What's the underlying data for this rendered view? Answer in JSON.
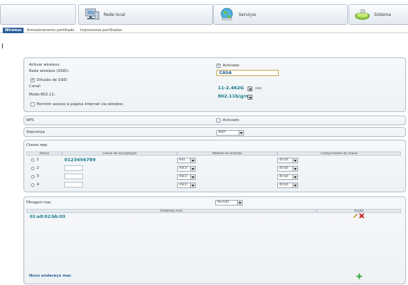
{
  "nav": {
    "tabs": [
      {
        "label": "Rede local",
        "icon": "network-monitor-icon"
      },
      {
        "label": "Serviços",
        "icon": "globe-icon"
      },
      {
        "label": "Sistema",
        "icon": "system-device-icon"
      }
    ]
  },
  "subtabs": [
    "Wireless",
    "Armazenamento partilhado",
    "Impressoras partilhadas"
  ],
  "wireless": {
    "activate_label": "Activar wireless:",
    "activate_checkbox": "Activado",
    "ssid_label": "Rede wireless (SSID):",
    "ssid_value": "CASA",
    "ssid_broadcast": "Difusão de SSID",
    "channel_label": "Canal:",
    "channel_value": "11-2.462G",
    "channel_unit": "(Hz)",
    "mode_label": "Modo 802.11:",
    "mode_value": "802.11b/g/n",
    "internet_access": "Permitir acesso à página Internet via wireless"
  },
  "wps": {
    "title": "WPS",
    "checkbox": "Activado"
  },
  "security": {
    "title": "Segurança",
    "value": "WEP"
  },
  "wep": {
    "title": "Chaves wep",
    "headers": [
      "Activo",
      "Chave de encriptação",
      "Método de entrada",
      "Comprimento da chave"
    ],
    "rows": [
      {
        "index": "1",
        "key": "0123456789",
        "method": "Hex",
        "length": "40 bit"
      },
      {
        "index": "2",
        "key": "",
        "method": "ASCII",
        "length": "40 bit"
      },
      {
        "index": "3",
        "key": "",
        "method": "ASCII",
        "length": "40 bit"
      },
      {
        "index": "4",
        "key": "",
        "method": "ASCII",
        "length": "40 bit"
      }
    ]
  },
  "mac": {
    "title": "Filtragem mac",
    "filter_value": "Permitir",
    "headers": [
      "Endereço mac",
      "Acção"
    ],
    "rows": [
      {
        "address": "01:e8:02:bb:03"
      }
    ],
    "new_link": "Novo endereço mac"
  },
  "colors": {
    "accent": "#2a5f9a",
    "value_teal": "#167a8a",
    "highlight_border": "#c9a64a"
  }
}
